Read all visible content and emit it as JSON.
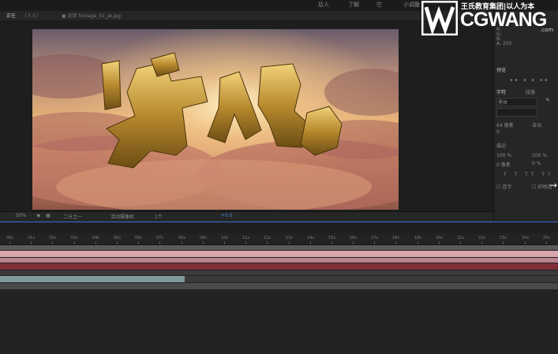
{
  "menubar": {
    "items": [
      "后人",
      "了解",
      "它",
      "小调整"
    ]
  },
  "panel": {
    "tab_composition": "正在",
    "tab_composition_sub": "（人人）",
    "tab_file": "▣ 运用 footage_01_JA.jpg"
  },
  "logo": {
    "chinese": "王氏教育集团|以人为本",
    "english": "CGWANG",
    "suffix": ".com"
  },
  "viewer_toolbar": {
    "zoom": "50%",
    "resolution": "二分之一",
    "camera": "活动摄像机",
    "views": "1个",
    "exposure": "+0.0"
  },
  "right_panel": {
    "info_labels": [
      "R:",
      "G:",
      "B:",
      "A: 255"
    ],
    "preview_title": "预览",
    "tabs": [
      "字符",
      "段落"
    ],
    "font_name": "黑体",
    "font_size": "64 像素",
    "leading": "自动",
    "tracking": "0",
    "stroke": "描边",
    "scale_v": "100 %",
    "scale_h": "100 %",
    "baseline": "0 像素",
    "tsume": "0 %",
    "ligature": "连字",
    "hindi": "印地语"
  },
  "timeline": {
    "ruler_labels": [
      "00s",
      "01s",
      "02s",
      "03s",
      "04s",
      "05s",
      "06s",
      "07s",
      "08s",
      "09s",
      "10s",
      "11s",
      "12s",
      "13s",
      "14s",
      "15s",
      "16s",
      "17s",
      "18s",
      "19s",
      "20s",
      "21s",
      "22s",
      "23s",
      "24s",
      "25s"
    ]
  },
  "colors": {
    "accent_blue": "#3b6fd6",
    "track_pink": "#d9a6ae",
    "track_red": "#7d2f36",
    "track_teal": "#7f9a9a"
  },
  "icons": [
    "pan-icon",
    "camera-icon",
    "grid-icon",
    "arrow-right-icon",
    "eyedropper-icon"
  ]
}
